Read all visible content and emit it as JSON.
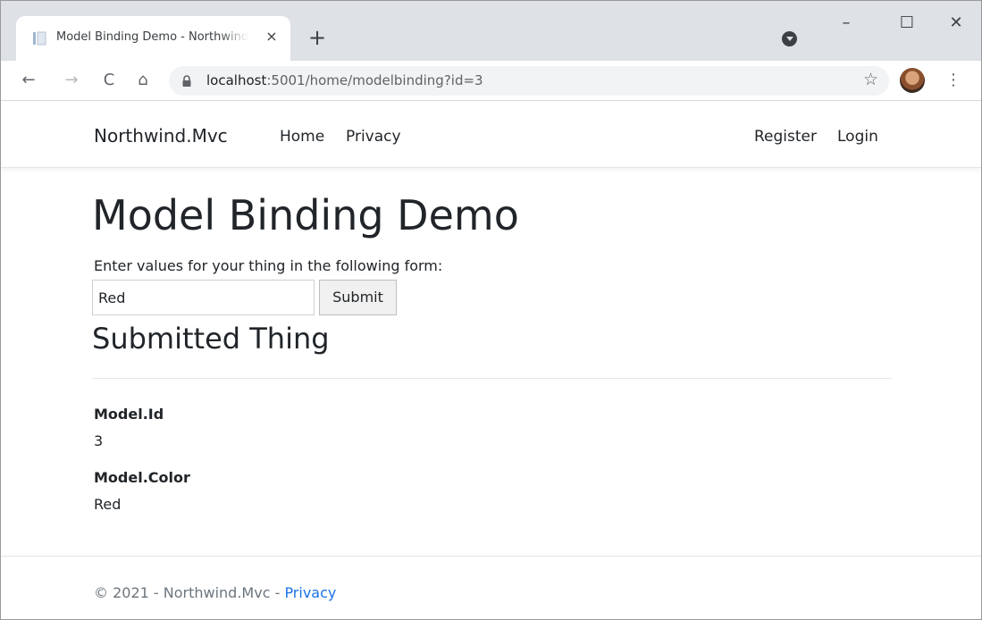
{
  "browser": {
    "tab_title": "Model Binding Demo - Northwind.Mvc",
    "tab_close": "×",
    "new_tab": "+",
    "window_controls": {
      "minimize": "–",
      "maximize": "☐",
      "close": "✕"
    },
    "nav": {
      "back": "←",
      "forward": "→",
      "reload": "C",
      "home": "⌂"
    },
    "url_host": "localhost",
    "url_rest": ":5001/home/modelbinding?id=3",
    "bookmark": "☆",
    "menu": "⋮",
    "icons": [
      "page-favicon-icon",
      "close-icon",
      "plus-icon",
      "extension-icon",
      "minimize-icon",
      "maximize-icon",
      "close-window-icon",
      "back-arrow-icon",
      "forward-arrow-icon",
      "reload-icon",
      "home-icon",
      "lock-icon",
      "star-icon",
      "profile-avatar",
      "kebab-menu-icon"
    ]
  },
  "navbar": {
    "brand": "Northwind.Mvc",
    "links": [
      "Home",
      "Privacy"
    ],
    "right_links": [
      "Register",
      "Login"
    ]
  },
  "main": {
    "title": "Model Binding Demo",
    "form_prompt": "Enter values for your thing in the following form:",
    "input_value": "Red",
    "submit_label": "Submit",
    "submitted_heading": "Submitted Thing",
    "fields": [
      {
        "label": "Model.Id",
        "value": "3"
      },
      {
        "label": "Model.Color",
        "value": "Red"
      }
    ]
  },
  "footer": {
    "text": "© 2021 - Northwind.Mvc - ",
    "link": "Privacy"
  },
  "colors": {
    "tabstrip": "#dee1e6",
    "link_blue": "#1a73e8",
    "text": "#212529",
    "muted": "#6c757d"
  }
}
